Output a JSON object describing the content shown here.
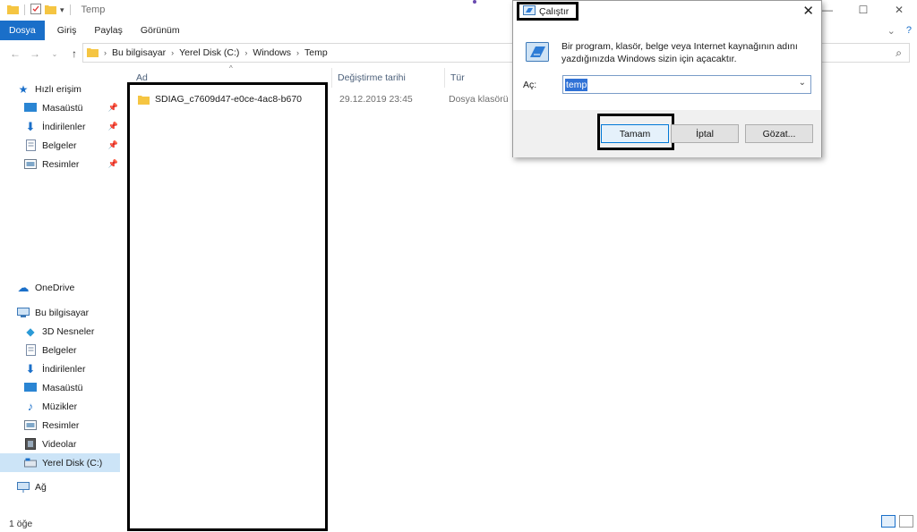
{
  "window": {
    "title": "Temp"
  },
  "ribbon": {
    "tabs": [
      "Dosya",
      "Giriş",
      "Paylaş",
      "Görünüm"
    ]
  },
  "address": {
    "crumbs": [
      "Bu bilgisayar",
      "Yerel Disk (C:)",
      "Windows",
      "Temp"
    ]
  },
  "navpane": {
    "quick_access": "Hızlı erişim",
    "quick_items": [
      "Masaüstü",
      "İndirilenler",
      "Belgeler",
      "Resimler"
    ],
    "onedrive": "OneDrive",
    "this_pc": "Bu bilgisayar",
    "pc_items": [
      "3D Nesneler",
      "Belgeler",
      "İndirilenler",
      "Masaüstü",
      "Müzikler",
      "Resimler",
      "Videolar",
      "Yerel Disk (C:)"
    ],
    "network": "Ağ"
  },
  "columns": {
    "name": "Ad",
    "modified": "Değiştirme tarihi",
    "type": "Tür"
  },
  "files": [
    {
      "name": "SDIAG_c7609d47-e0ce-4ac8-b670",
      "modified": "29.12.2019 23:45",
      "type": "Dosya klasörü"
    }
  ],
  "status": {
    "count": "1 öğe"
  },
  "run_dialog": {
    "title": "Çalıştır",
    "description": "Bir program, klasör, belge veya Internet kaynağının adını yazdığınızda Windows sizin için açacaktır.",
    "open_label": "Aç:",
    "value": "temp",
    "ok": "Tamam",
    "cancel": "İptal",
    "browse": "Gözat..."
  },
  "colors": {
    "accent": "#1a6fc9",
    "selection": "#3072d6",
    "nav_selected": "#cce4f7"
  }
}
